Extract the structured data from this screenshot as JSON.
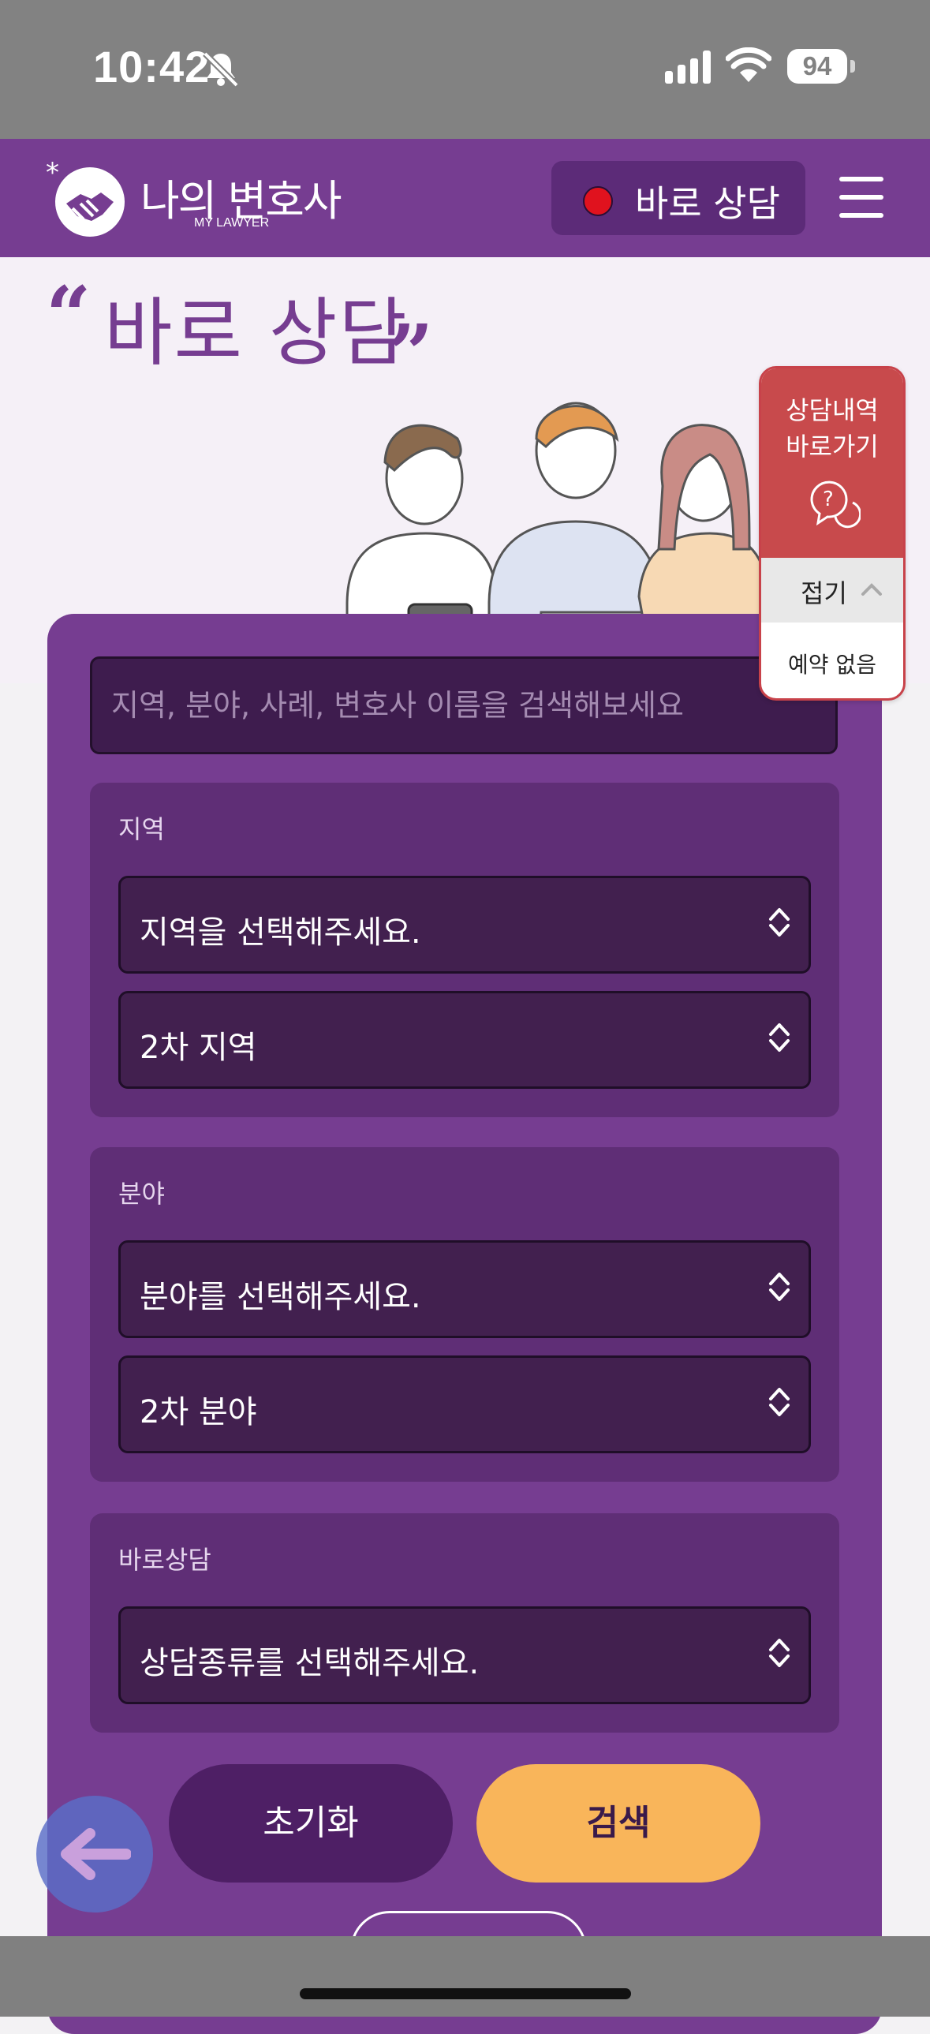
{
  "status_bar": {
    "time": "10:42",
    "battery": "94"
  },
  "header": {
    "logo_title": "나의 변호사",
    "logo_subtitle": "MY LAWYER",
    "consult_button": "바로 상담"
  },
  "hero": {
    "title": "바로 상담"
  },
  "search": {
    "placeholder": "지역, 분야, 사례, 변호사 이름을 검색해보세요"
  },
  "sections": {
    "region": {
      "label": "지역",
      "select_primary": "지역을 선택해주세요.",
      "select_secondary": "2차 지역"
    },
    "field": {
      "label": "분야",
      "select_primary": "분야를 선택해주세요.",
      "select_secondary": "2차 분야"
    },
    "consult": {
      "label": "바로상담",
      "select_primary": "상담종류를 선택해주세요."
    }
  },
  "buttons": {
    "reset": "초기화",
    "search": "검색"
  },
  "history_widget": {
    "title_line1": "상담내역",
    "title_line2": "바로가기",
    "collapse": "접기",
    "empty_text": "예약 없음"
  },
  "colors": {
    "brand_purple": "#763d91",
    "section_purple": "#5f2e76",
    "select_dark": "#42204f",
    "accent_orange": "#f9b55a",
    "widget_red": "#c84a4c"
  }
}
